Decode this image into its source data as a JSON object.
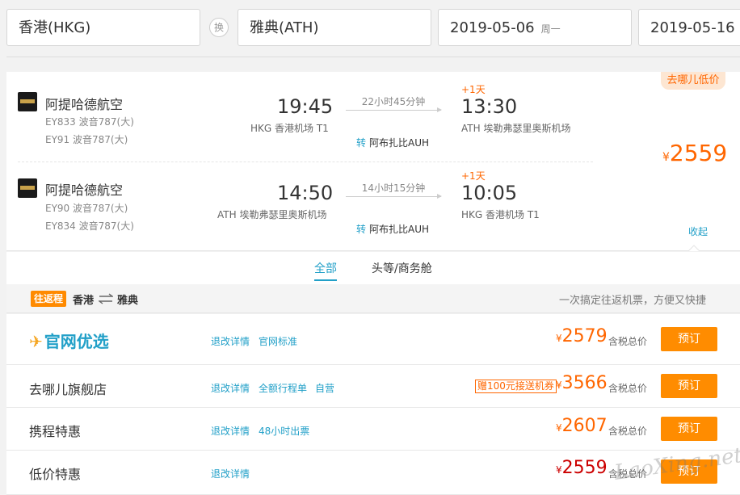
{
  "search": {
    "from": "香港(HKG)",
    "swap_label": "换",
    "to": "雅典(ATH)",
    "depart_date": "2019-05-06",
    "depart_weekday": "周一",
    "return_date": "2019-05-16"
  },
  "flight": {
    "tag": "去哪儿低价",
    "price_symbol": "¥",
    "price": "2559",
    "collapse_label": "收起",
    "outbound": {
      "airline": "阿提哈德航空",
      "flight1": "EY833 波音787(大)",
      "flight2": "EY91 波音787(大)",
      "dep_time": "19:45",
      "dep_airport": "HKG 香港机场 T1",
      "duration": "22小时45分钟",
      "transfer_label": "转",
      "transfer_city": "阿布扎比AUH",
      "day_offset": "+1天",
      "arr_time": "13:30",
      "arr_airport": "ATH 埃勒弗瑟里奥斯机场"
    },
    "inbound": {
      "airline": "阿提哈德航空",
      "flight1": "EY90 波音787(大)",
      "flight2": "EY834 波音787(大)",
      "dep_time": "14:50",
      "dep_airport": "ATH 埃勒弗瑟里奥斯机场",
      "duration": "14小时15分钟",
      "transfer_label": "转",
      "transfer_city": "阿布扎比AUH",
      "day_offset": "+1天",
      "arr_time": "10:05",
      "arr_airport": "HKG 香港机场 T1"
    }
  },
  "tabs": [
    "全部",
    "头等/商务舱"
  ],
  "roundtrip": {
    "badge": "往返程",
    "from": "香港",
    "to": "雅典",
    "note": "一次搞定往返机票，方便又快捷"
  },
  "vendors": [
    {
      "name": "官网优选",
      "links": [
        "退改详情",
        "官网标准"
      ],
      "promo": "",
      "price": "2579",
      "tax_label": "含税总价",
      "book_label": "预订"
    },
    {
      "name": "去哪儿旗舰店",
      "links": [
        "退改详情",
        "全额行程单",
        "自营"
      ],
      "promo": "赠100元接送机券",
      "price": "3566",
      "tax_label": "含税总价",
      "book_label": "预订"
    },
    {
      "name": "携程特惠",
      "links": [
        "退改详情",
        "48小时出票"
      ],
      "promo": "",
      "price": "2607",
      "tax_label": "含税总价",
      "book_label": "预订"
    },
    {
      "name": "低价特惠",
      "links": [
        "退改详情"
      ],
      "promo": "",
      "price": "2559",
      "tax_label": "含税总价",
      "book_label": "预订"
    }
  ],
  "watermark": "LaoXing.net",
  "colors": {
    "accent": "#ff6600",
    "link": "#22a0c8",
    "button": "#ff8c00"
  }
}
